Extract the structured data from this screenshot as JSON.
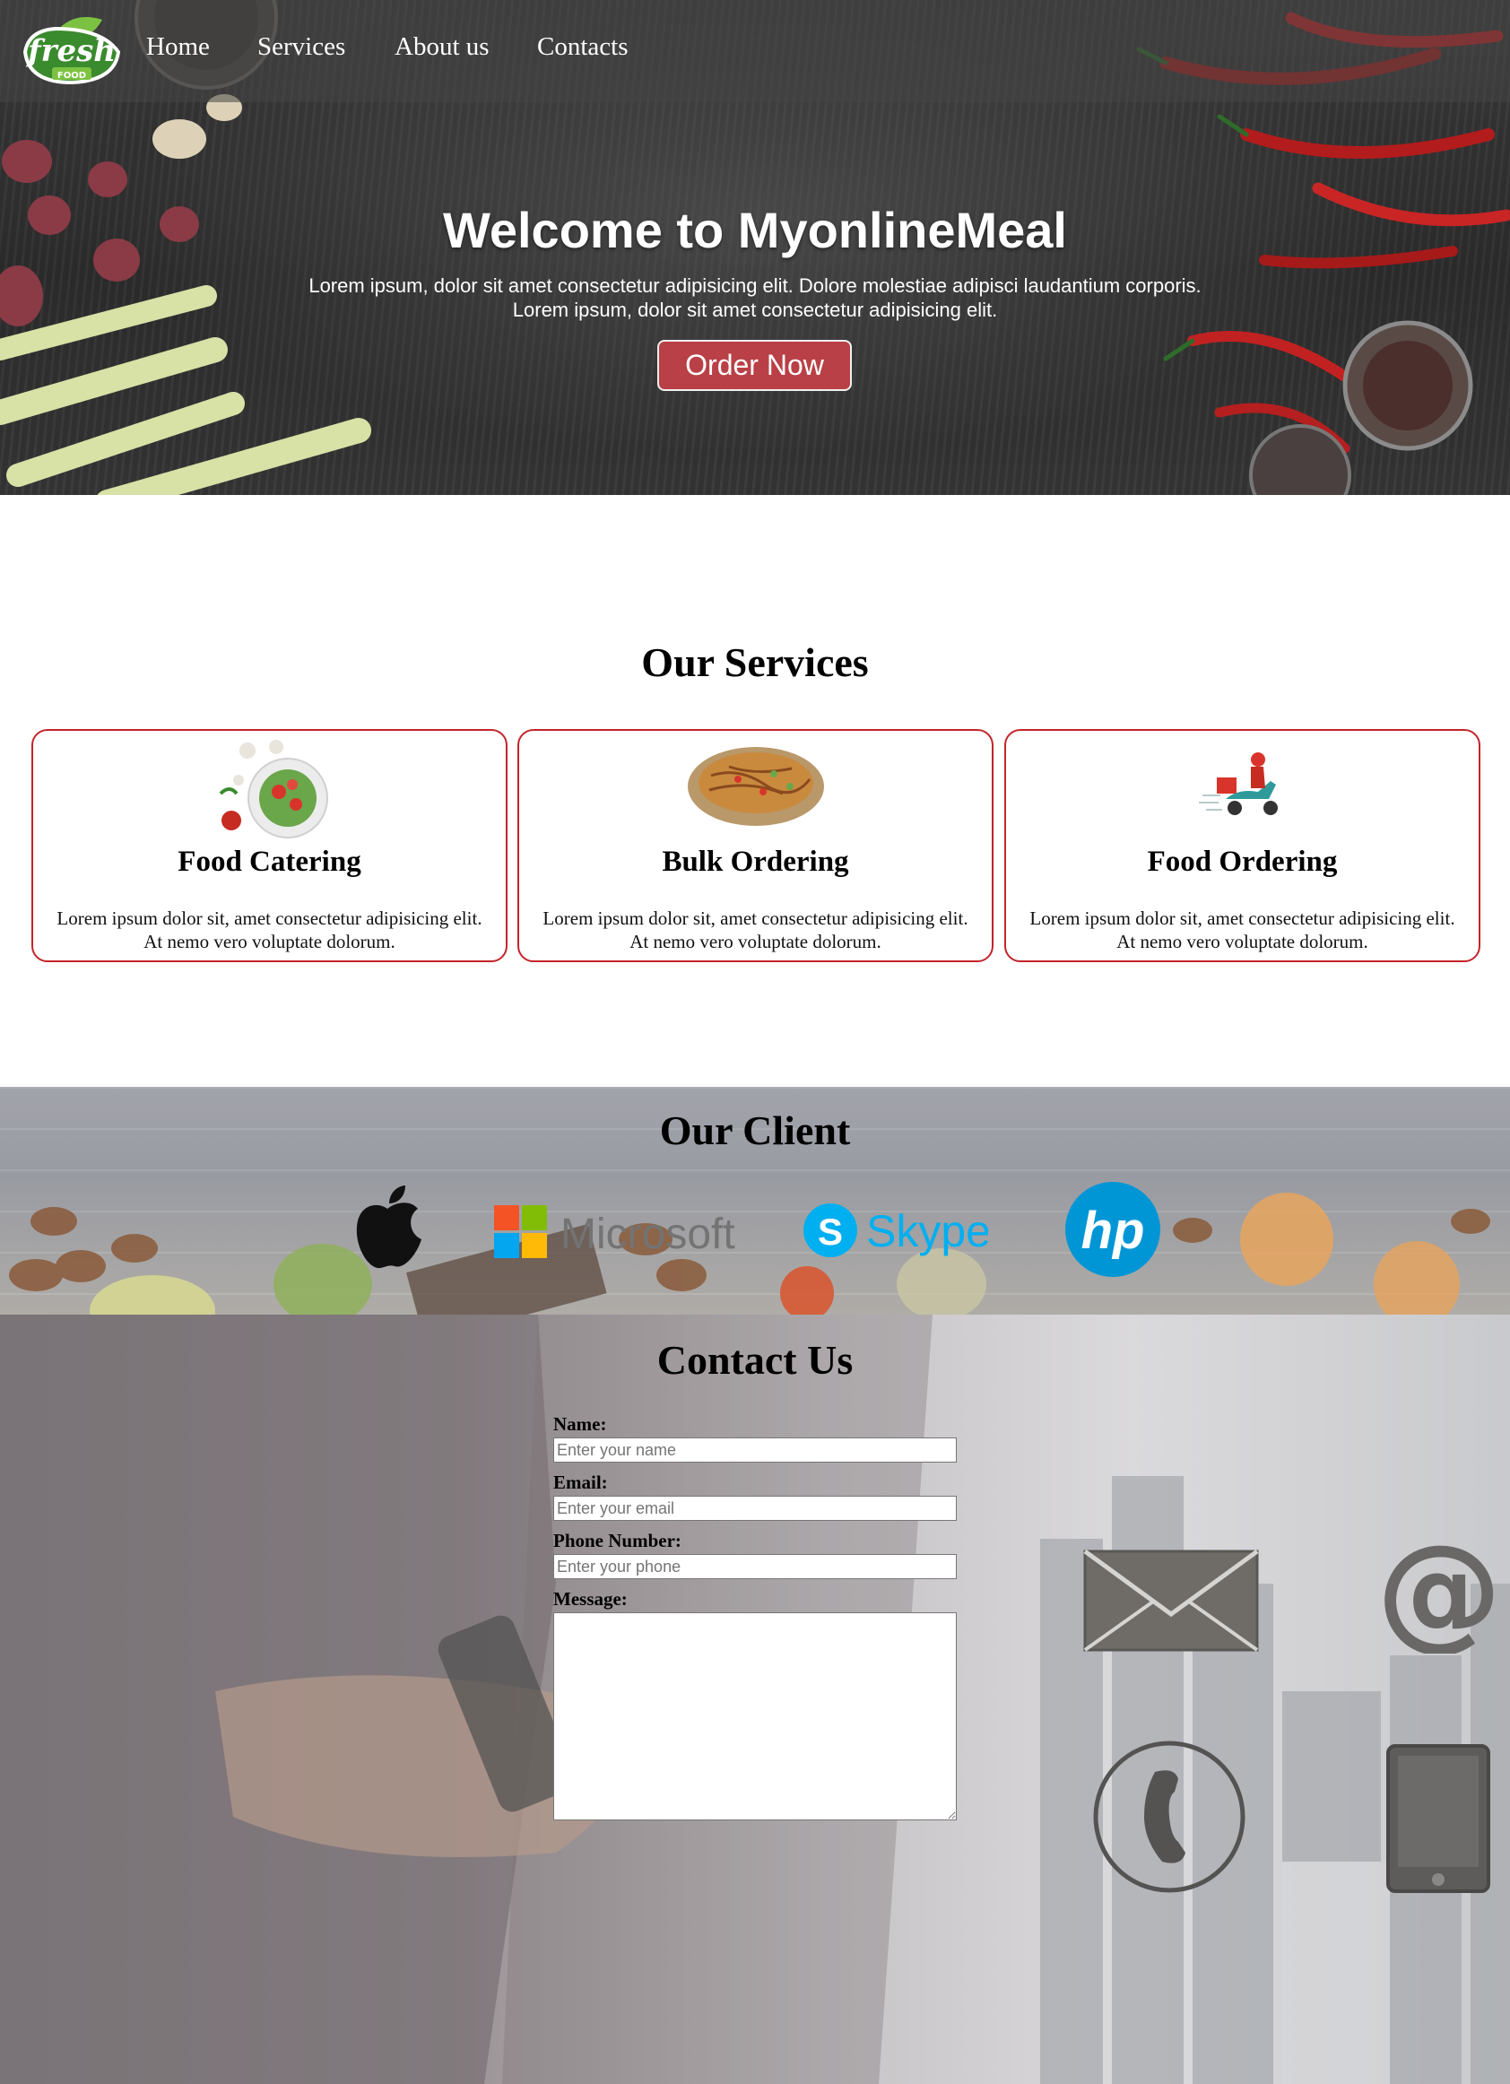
{
  "nav": {
    "logo": {
      "word": "fresh",
      "sub": "FOOD"
    },
    "links": [
      "Home",
      "Services",
      "About us",
      "Contacts"
    ]
  },
  "hero": {
    "title": "Welcome to MyonlineMeal",
    "line1": "Lorem ipsum, dolor sit amet consectetur adipisicing elit. Dolore molestiae adipisci laudantium corporis.",
    "line2": "Lorem ipsum, dolor sit amet consectetur adipisicing elit.",
    "cta": "Order Now"
  },
  "services": {
    "title": "Our Services",
    "cards": [
      {
        "title": "Food Catering",
        "text": "Lorem ipsum dolor sit, amet consectetur adipisicing elit. At nemo vero voluptate dolorum."
      },
      {
        "title": "Bulk Ordering",
        "text": "Lorem ipsum dolor sit, amet consectetur adipisicing elit. At nemo vero voluptate dolorum."
      },
      {
        "title": "Food Ordering",
        "text": "Lorem ipsum dolor sit, amet consectetur adipisicing elit. At nemo vero voluptate dolorum."
      }
    ]
  },
  "clients": {
    "title": "Our Client",
    "brands": [
      "apple-icon",
      "Microsoft",
      "Skype",
      "hp"
    ]
  },
  "contact": {
    "title": "Contact Us",
    "name_label": "Name:",
    "name_placeholder": "Enter your name",
    "email_label": "Email:",
    "email_placeholder": "Enter your email",
    "phone_label": "Phone Number:",
    "phone_placeholder": "Enter your phone",
    "message_label": "Message:"
  },
  "colors": {
    "accent_red": "#b94046",
    "card_border": "#c4242b",
    "microsoft_blue": "#00a4ef",
    "skype_blue": "#00aff0",
    "hp_blue": "#0096d6"
  }
}
